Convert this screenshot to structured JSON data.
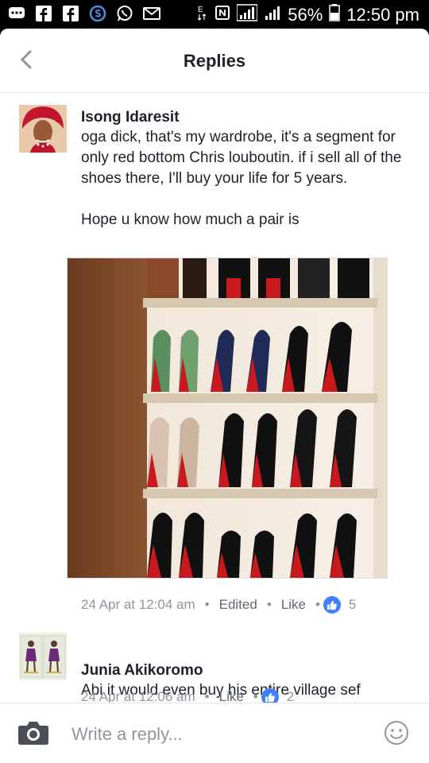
{
  "status_bar": {
    "battery": "56%",
    "time": "12:50 pm"
  },
  "header": {
    "title": "Replies"
  },
  "comments": [
    {
      "name": "Isong Idaresit",
      "text": "oga dick, that's my wardrobe, it's a segment for only red bottom Chris louboutin. if i sell all of the shoes there, I'll buy your life for 5 years.\n\nHope u know how much a pair is",
      "time": "24 Apr at 12:04 am",
      "edited": "Edited",
      "like": "Like",
      "likes": "5"
    },
    {
      "name": "Junia Akikoromo",
      "text": "Abi it would even buy his entire village sef",
      "time": "24 Apr at 12:06 am",
      "like": "Like",
      "likes": "2"
    }
  ],
  "footer": {
    "placeholder": "Write a reply..."
  },
  "colors": {
    "like_blue": "#4080ff",
    "meta_gray": "#90949c"
  }
}
